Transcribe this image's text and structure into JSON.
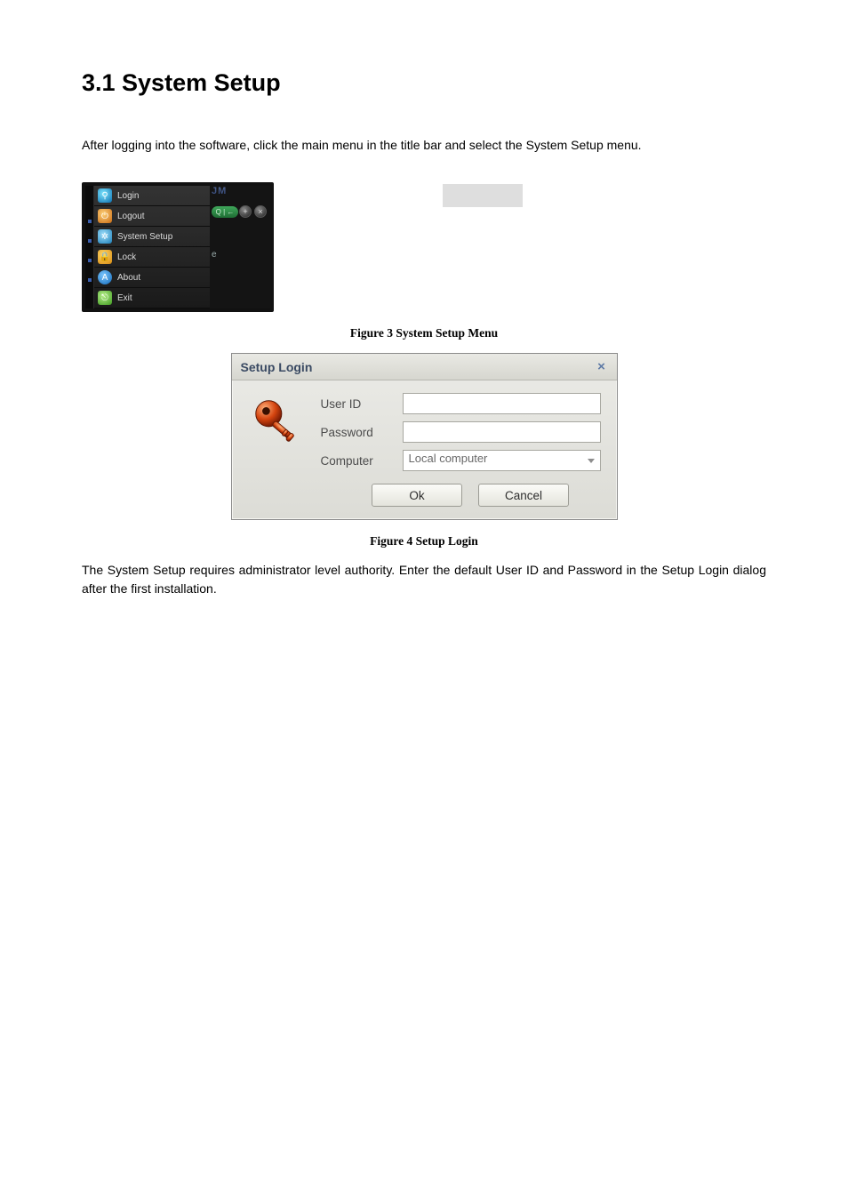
{
  "heading": "3.1 System Setup",
  "intro": "After logging into the software, click the main menu in the title bar and select the System Setup menu.",
  "menu": {
    "watermark": "JM",
    "items": [
      {
        "label": "Login"
      },
      {
        "label": "Logout"
      },
      {
        "label": "System Setup"
      },
      {
        "label": "Lock"
      },
      {
        "label": "About"
      },
      {
        "label": "Exit"
      }
    ],
    "search_back": "Q | ←",
    "plus": "+",
    "close": "×",
    "stub_e": "e"
  },
  "captions": {
    "fig3": "Figure 3 System Setup Menu",
    "fig4": "Figure 4 Setup Login"
  },
  "dialog": {
    "title": "Setup Login",
    "close": "×",
    "fields": {
      "userid_label": "User ID",
      "userid_value": "",
      "password_label": "Password",
      "password_value": "",
      "computer_label": "Computer",
      "computer_value": "Local computer"
    },
    "buttons": {
      "ok": "Ok",
      "cancel": "Cancel"
    }
  },
  "closing": "The System Setup requires administrator level authority. Enter the default User ID and Password in the Setup Login dialog after the first installation."
}
